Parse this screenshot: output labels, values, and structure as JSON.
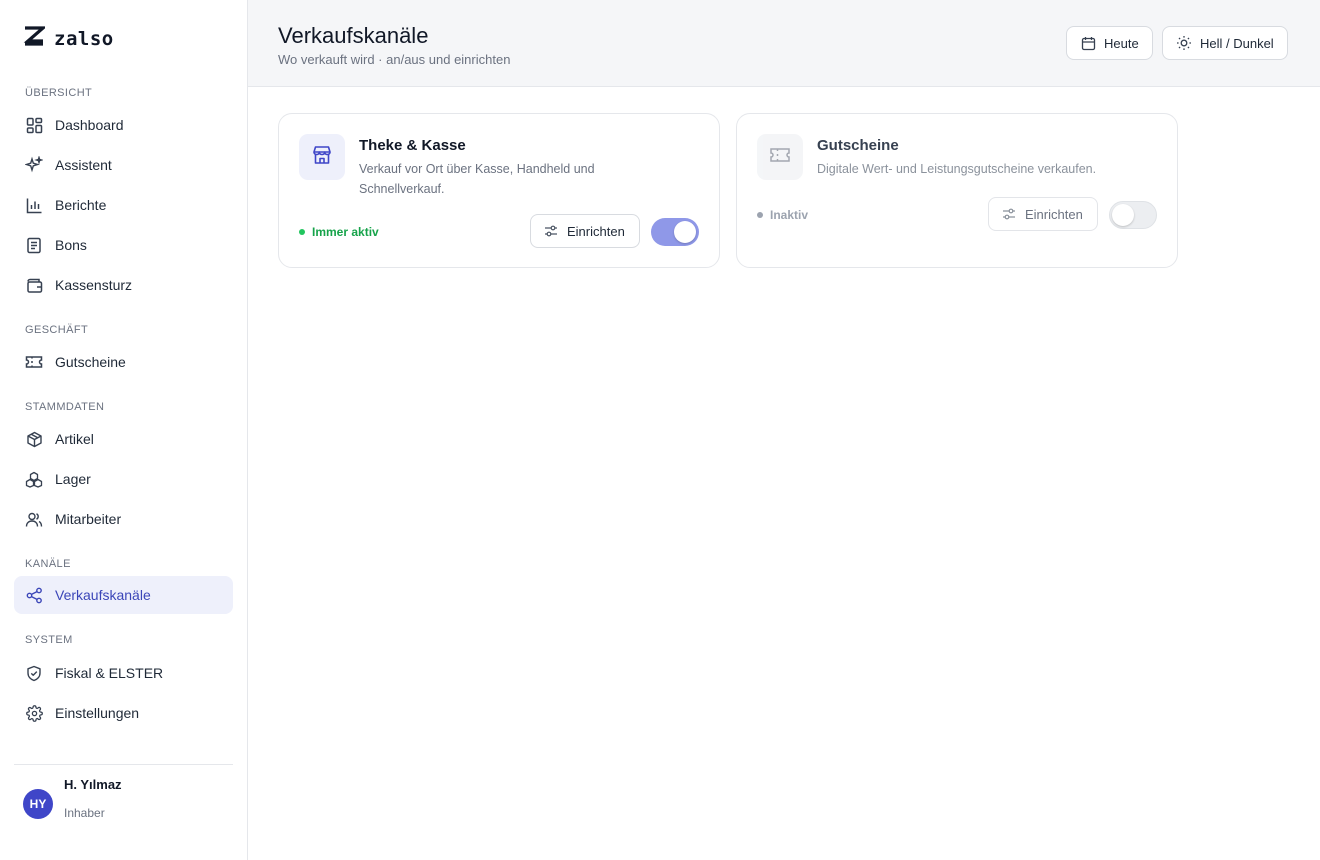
{
  "app": {
    "name": "zalso",
    "logo_icon": "z-logo-icon"
  },
  "sidebar": {
    "sections": [
      {
        "label": "ÜBERSICHT"
      },
      {
        "label": "GESCHÄFT"
      },
      {
        "label": "STAMMDATEN"
      },
      {
        "label": "KANÄLE"
      },
      {
        "label": "SYSTEM"
      }
    ],
    "items": [
      {
        "label": "Dashboard",
        "icon": "grid-icon"
      },
      {
        "label": "Assistent",
        "icon": "sparkles-icon"
      },
      {
        "label": "Berichte",
        "icon": "bar-chart-icon"
      },
      {
        "label": "Bons",
        "icon": "receipt-icon"
      },
      {
        "label": "Kassensturz",
        "icon": "wallet-icon"
      },
      {
        "label": "Gutscheine",
        "icon": "ticket-icon"
      },
      {
        "label": "Artikel",
        "icon": "box-icon"
      },
      {
        "label": "Lager",
        "icon": "boxes-icon"
      },
      {
        "label": "Mitarbeiter",
        "icon": "users-icon"
      },
      {
        "label": "Verkaufskanäle",
        "icon": "share-icon",
        "active": true
      },
      {
        "label": "Fiskal & ELSTER",
        "icon": "shield-icon"
      },
      {
        "label": "Einstellungen",
        "icon": "gear-icon"
      }
    ]
  },
  "user": {
    "initials": "HY",
    "name": "H. Yılmaz",
    "role": "Inhaber"
  },
  "header": {
    "title": "Verkaufskanäle",
    "subtitle": "Wo verkauft wird · an/aus und einrichten",
    "today_label": "Heute",
    "theme_label": "Hell / Dunkel"
  },
  "channels": [
    {
      "title": "Theke & Kasse",
      "description": "Verkauf vor Ort über Kasse, Handheld und Schnellverkauf.",
      "status": "Immer aktiv",
      "setup_label": "Einrichten",
      "enabled": true,
      "icon": "store-icon"
    },
    {
      "title": "Gutscheine",
      "description": "Digitale Wert- und Leistungsgutscheine verkaufen.",
      "status": "Inaktiv",
      "setup_label": "Einrichten",
      "enabled": false,
      "icon": "ticket-icon"
    }
  ],
  "colors": {
    "accent": "#3f46c8",
    "active_nav_bg": "#eef0fb",
    "toggle_on": "#8f98e8",
    "status_active": "#16a34a",
    "status_inactive": "#9ca3af"
  }
}
